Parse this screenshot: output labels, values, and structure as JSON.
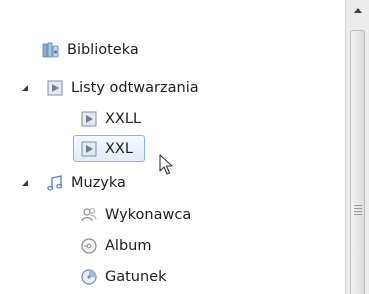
{
  "tree": {
    "biblioteka": {
      "label": "Biblioteka",
      "icon": "library-icon"
    },
    "playlists": {
      "label": "Listy odtwarzania",
      "icon": "playlist-icon",
      "expanded": true,
      "items": [
        {
          "label": "XXLL",
          "icon": "playlist-icon"
        },
        {
          "label": "XXL",
          "icon": "playlist-icon",
          "selected": true
        }
      ]
    },
    "music": {
      "label": "Muzyka",
      "icon": "music-note-icon",
      "expanded": true,
      "items": [
        {
          "label": "Wykonawca",
          "icon": "artist-icon"
        },
        {
          "label": "Album",
          "icon": "album-icon"
        },
        {
          "label": "Gatunek",
          "icon": "genre-icon"
        }
      ]
    }
  },
  "colors": {
    "selection_border": "#8db2e3",
    "selection_fill": "#e3ecf8",
    "text": "#1e1e1e"
  }
}
